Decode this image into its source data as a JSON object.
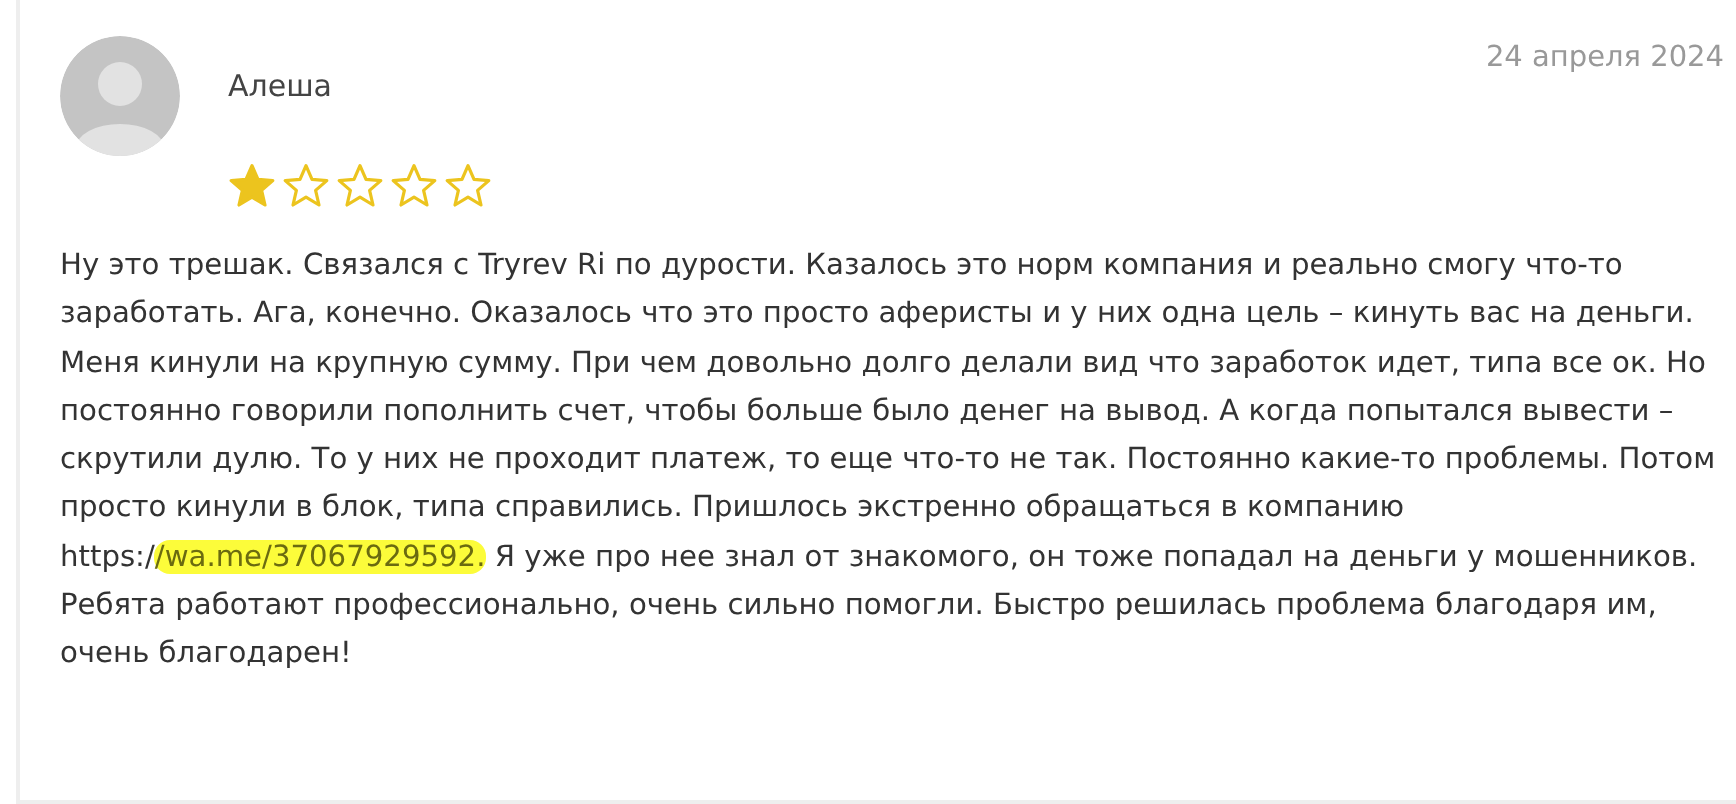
{
  "review": {
    "author": "Алеша",
    "date": "24 апреля 2024",
    "stars": 1,
    "text_before": "Ну это трешак. Связался с Tryrev Ri по дурости. Казалось это норм компания и реально смогу что-то заработать. Ага, конечно. Оказалось что это просто аферисты и у них одна цель – кинуть вас на деньги. Меня кинули на крупную сумму. При чем довольно долго делали вид что заработок идет, типа все ок. Но постоянно говорили пополнить счет, чтобы больше было денег на вывод. А когда попытался вывести – скрутили дулю. То у них не проходит платеж, то еще что-то не так. Постоянно какие-то проблемы. Потом просто кинули в блок, типа справились. Пришлось экстренно обращаться в компанию ",
    "link_prefix": "https:/",
    "link_highlighted": "/wa.me/37067929592.",
    "text_after": " Я уже про нее знал от знакомого, он тоже попадал на деньги у мошенников. Ребята работают профессионально, очень сильно помогли. Быстро решилась проблема благодаря им, очень благодарен!"
  }
}
